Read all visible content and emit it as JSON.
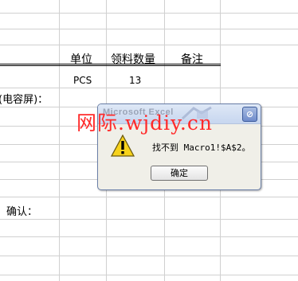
{
  "sheet": {
    "col_unit": "单位",
    "col_qty": "领料数量",
    "col_remark": "备注",
    "row1_unit": "PCS",
    "row1_qty": "13",
    "left_label": "(电容屏)：",
    "confirm_label": "确认："
  },
  "watermark": {
    "text": "网际.wjdiy.cn"
  },
  "dialog": {
    "title": "Microsoft Excel",
    "message": "找不到 Macro1!$A$2。",
    "ok_label": "确定"
  },
  "icons": {
    "warning": "warning-icon",
    "close": "close-icon"
  },
  "colors": {
    "watermark": "#ff2a2a",
    "titlebar": "#c7d6ef",
    "dialog_bg": "#f0efe8"
  }
}
